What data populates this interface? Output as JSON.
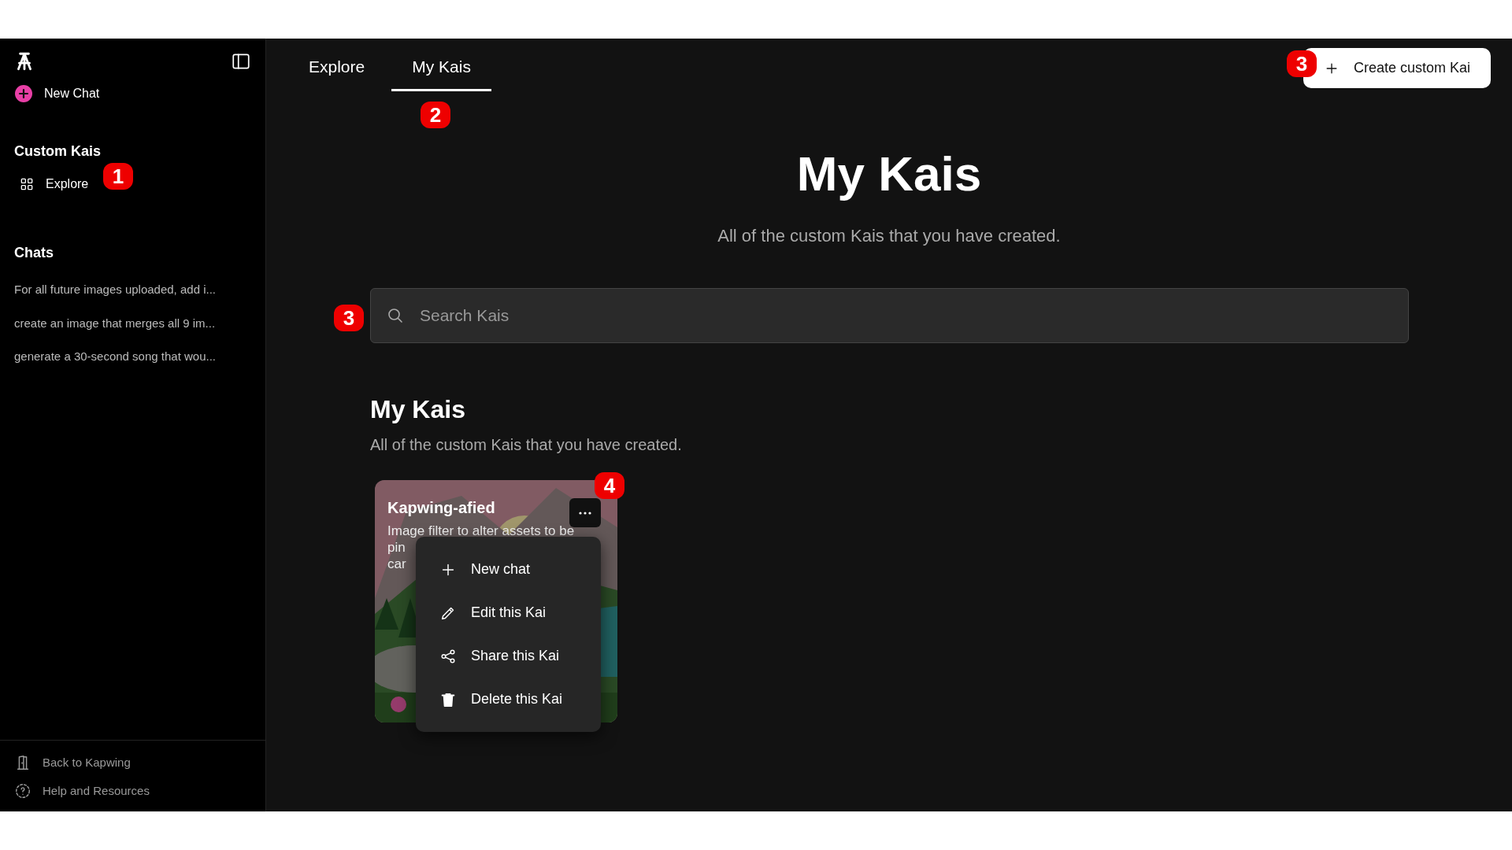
{
  "sidebar": {
    "new_chat": "New Chat",
    "custom_kais": {
      "heading": "Custom Kais",
      "items": [
        {
          "label": "Explore"
        }
      ]
    },
    "chats": {
      "heading": "Chats",
      "items": [
        "For all future images uploaded, add i...",
        "create an image that merges all 9 im...",
        "generate a 30-second song that wou..."
      ]
    },
    "footer": [
      "Back to Kapwing",
      "Help and Resources"
    ]
  },
  "tabs": [
    {
      "label": "Explore",
      "selected": false
    },
    {
      "label": "My Kais",
      "selected": true
    }
  ],
  "create_button": "Create custom Kai",
  "header": {
    "title": "My Kais",
    "subtitle": "All of the custom Kais that you have created."
  },
  "search": {
    "placeholder": "Search Kais"
  },
  "section": {
    "title": "My Kais",
    "subtitle": "All of the custom Kais that you have created."
  },
  "cards": [
    {
      "title": "Kapwing-afied",
      "description": [
        "Image filter to alter assets to be",
        "pin",
        "car"
      ],
      "kind": "picture"
    }
  ],
  "menu": {
    "items": [
      {
        "label": "New chat",
        "kind": "plus"
      },
      {
        "label": "Edit this Kai",
        "kind": "pencil"
      },
      {
        "label": "Share this Kai",
        "kind": "share"
      },
      {
        "label": "Delete this Kai",
        "kind": "trash"
      }
    ]
  },
  "annotations": [
    "1",
    "2",
    "3",
    "3",
    "4"
  ]
}
